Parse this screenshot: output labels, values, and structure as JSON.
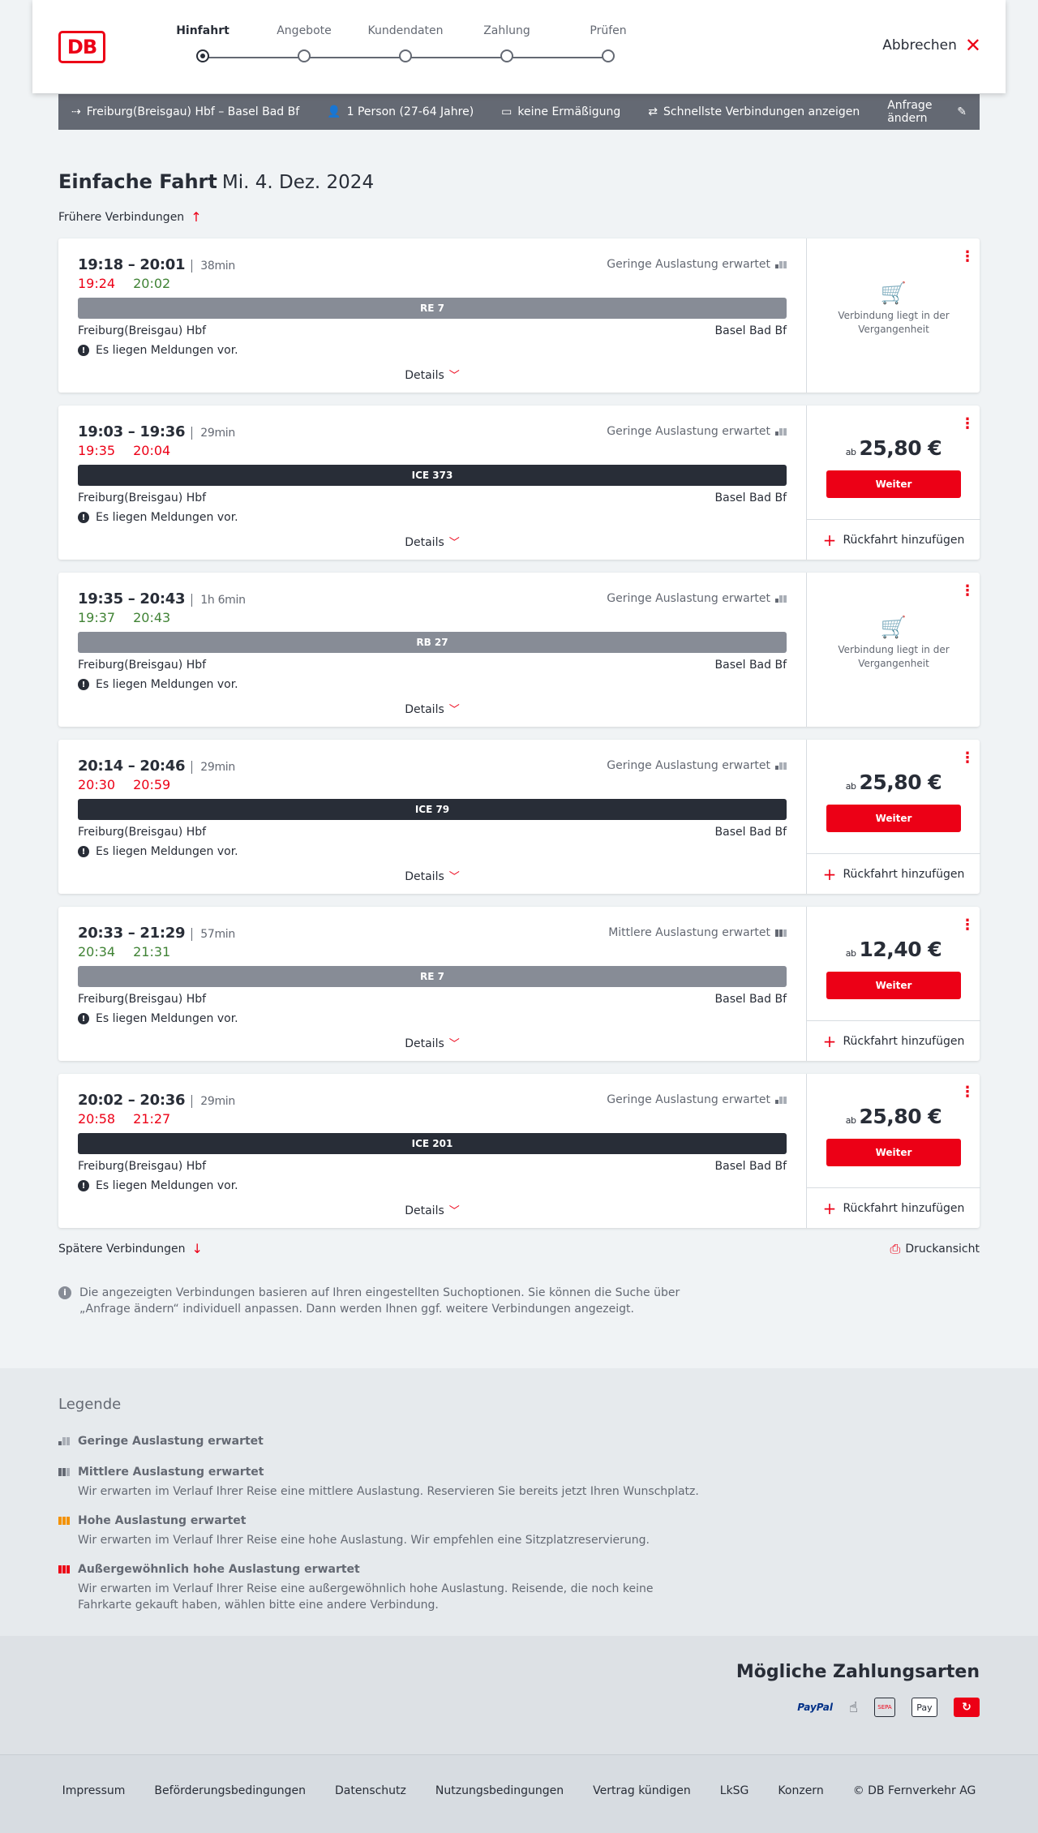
{
  "header": {
    "logo": "DB",
    "steps": [
      "Hinfahrt",
      "Angebote",
      "Kundendaten",
      "Zahlung",
      "Prüfen"
    ],
    "cancel": "Abbrechen"
  },
  "search": {
    "route": "Freiburg(Breisgau) Hbf – Basel Bad Bf",
    "passengers": "1 Person (27-64 Jahre)",
    "discount": "keine Ermäßigung",
    "fastest": "Schnellste Verbindungen anzeigen",
    "edit": "Anfrage ändern"
  },
  "page": {
    "title": "Einfache Fahrt",
    "date": "Mi. 4. Dez. 2024",
    "earlier": "Frühere Verbindungen",
    "later": "Spätere Verbindungen",
    "print": "Druckansicht"
  },
  "common": {
    "from": "Freiburg(Breisgau) Hbf",
    "to": "Basel Bad Bf",
    "message": "Es liegen Meldungen vor.",
    "details": "Details",
    "past": "Verbindung liegt in der Vergangenheit",
    "price_prefix": "ab",
    "weiter": "Weiter",
    "return": "Rückfahrt hinzufügen"
  },
  "connections": [
    {
      "times": "19:18 – 20:01",
      "duration": "38min",
      "rt_dep": "19:24",
      "rt_arr": "20:02",
      "load": "Geringe Auslastung erwartet",
      "train": "RE 7",
      "price": ""
    },
    {
      "times": "19:03 – 19:36",
      "duration": "29min",
      "rt_dep": "19:35",
      "rt_arr": "20:04",
      "load": "Geringe Auslastung erwartet",
      "train": "ICE 373",
      "price": "25,80 €"
    },
    {
      "times": "19:35 – 20:43",
      "duration": "1h 6min",
      "rt_dep": "19:37",
      "rt_arr": "20:43",
      "load": "Geringe Auslastung erwartet",
      "train": "RB 27",
      "price": ""
    },
    {
      "times": "20:14 – 20:46",
      "duration": "29min",
      "rt_dep": "20:30",
      "rt_arr": "20:59",
      "load": "Geringe Auslastung erwartet",
      "train": "ICE 79",
      "price": "25,80 €"
    },
    {
      "times": "20:33 – 21:29",
      "duration": "57min",
      "rt_dep": "20:34",
      "rt_arr": "21:31",
      "load": "Mittlere Auslastung erwartet",
      "train": "RE 7",
      "price": "12,40 €"
    },
    {
      "times": "20:02 – 20:36",
      "duration": "29min",
      "rt_dep": "20:58",
      "rt_arr": "21:27",
      "load": "Geringe Auslastung erwartet",
      "train": "ICE 201",
      "price": "25,80 €"
    }
  ],
  "info": "Die angezeigten Verbindungen basieren auf Ihren eingestellten Suchoptionen. Sie können die Suche über „Anfrage ändern“ individuell anpassen. Dann werden Ihnen ggf. weitere Verbindungen angezeigt.",
  "legend": {
    "title": "Legende",
    "items": [
      {
        "head": "Geringe Auslastung erwartet",
        "desc": ""
      },
      {
        "head": "Mittlere Auslastung erwartet",
        "desc": "Wir erwarten im Verlauf Ihrer Reise eine mittlere Auslastung. Reservieren Sie bereits jetzt Ihren Wunschplatz."
      },
      {
        "head": "Hohe Auslastung erwartet",
        "desc": "Wir erwarten im Verlauf Ihrer Reise eine hohe Auslastung. Wir empfehlen eine Sitzplatzreservierung."
      },
      {
        "head": "Außergewöhnlich hohe Auslastung erwartet",
        "desc": "Wir erwarten im Verlauf Ihrer Reise eine außergewöhnlich hohe Auslastung. Reisende, die noch keine Fahrkarte gekauft haben, wählen bitte eine andere Verbindung."
      }
    ]
  },
  "payment": {
    "title": "Mögliche Zahlungsarten",
    "paypal": "PayPal",
    "sepa": "SEPA",
    "applepay": "Pay"
  },
  "footer": [
    "Impressum",
    "Beförderungsbedingungen",
    "Datenschutz",
    "Nutzungsbedingungen",
    "Vertrag kündigen",
    "LkSG",
    "Konzern",
    "© DB Fernverkehr AG"
  ]
}
